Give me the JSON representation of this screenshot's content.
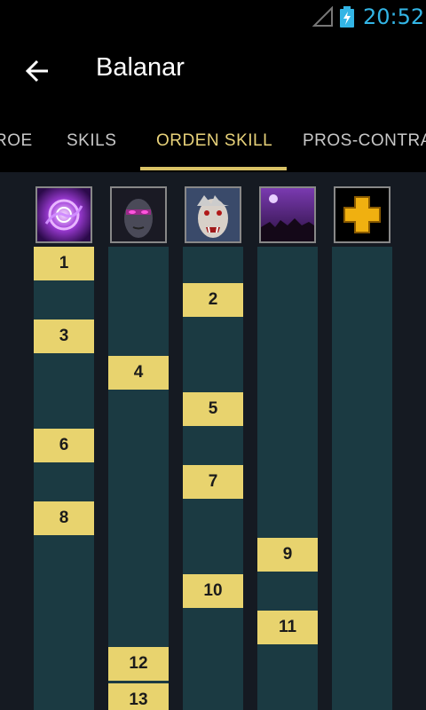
{
  "status_bar": {
    "time": "20:52",
    "signal_icon": "signal-icon",
    "battery_icon": "battery-charging-icon"
  },
  "action_bar": {
    "back_icon": "arrow-left-icon",
    "title": "Balanar"
  },
  "tabs": [
    {
      "label": "ROE",
      "active": false
    },
    {
      "label": "SKILS",
      "active": false
    },
    {
      "label": "ORDEN SKILL",
      "active": true
    },
    {
      "label": "PROS-CONTRA",
      "active": false
    }
  ],
  "skills": [
    {
      "name": "void-skill-icon",
      "levels": [
        "1",
        "3",
        "6",
        "8"
      ]
    },
    {
      "name": "dark-hero-skill-icon",
      "levels": [
        "4",
        "12",
        "13"
      ]
    },
    {
      "name": "vampire-skill-icon",
      "levels": [
        "2",
        "5",
        "7",
        "10"
      ]
    },
    {
      "name": "night-sky-skill-icon",
      "levels": [
        "9",
        "11"
      ]
    },
    {
      "name": "attribute-plus-icon",
      "levels": []
    }
  ],
  "colors": {
    "accent": "#e8d27a",
    "badge": "#e8d36e",
    "column": "#1b3a42",
    "status_time": "#33b5e5"
  }
}
